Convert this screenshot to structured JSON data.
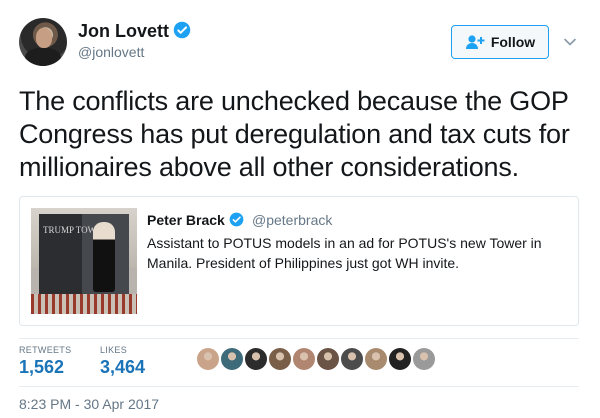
{
  "author": {
    "name": "Jon Lovett",
    "handle": "@jonlovett",
    "verified": true,
    "avatar_icon": "avatar-photo-icon"
  },
  "follow": {
    "label": "Follow",
    "icon": "add-user-icon",
    "accent": "#1da1f2"
  },
  "menu_icon": "chevron-down-icon",
  "tweet": {
    "text": "The conflicts are unchecked because the GOP Congress has put deregulation and tax cuts for millionaires above all other considerations."
  },
  "quote": {
    "name": "Peter Brack",
    "handle": "@peterbrack",
    "verified": true,
    "text": "Assistant to POTUS models in an ad for POTUS's new Tower in Manila. President of Philippines just got WH invite.",
    "image_text": "TRUMP TOWER"
  },
  "stats": {
    "retweets_label": "RETWEETS",
    "retweets_value": "1,562",
    "likes_label": "LIKES",
    "likes_value": "3,464",
    "liker_colors": [
      "#c9a48a",
      "#3d6b7a",
      "#2c2c2c",
      "#7a5f48",
      "#b08670",
      "#6b5446",
      "#4c4c4c",
      "#a88a6e",
      "#222222",
      "#9a9a9a"
    ]
  },
  "timestamp": "8:23 PM - 30 Apr 2017",
  "colors": {
    "text": "#14171a",
    "secondary": "#657786",
    "link": "#1b74b7",
    "verified": "#1da1f2",
    "border": "#e1e8ed"
  }
}
